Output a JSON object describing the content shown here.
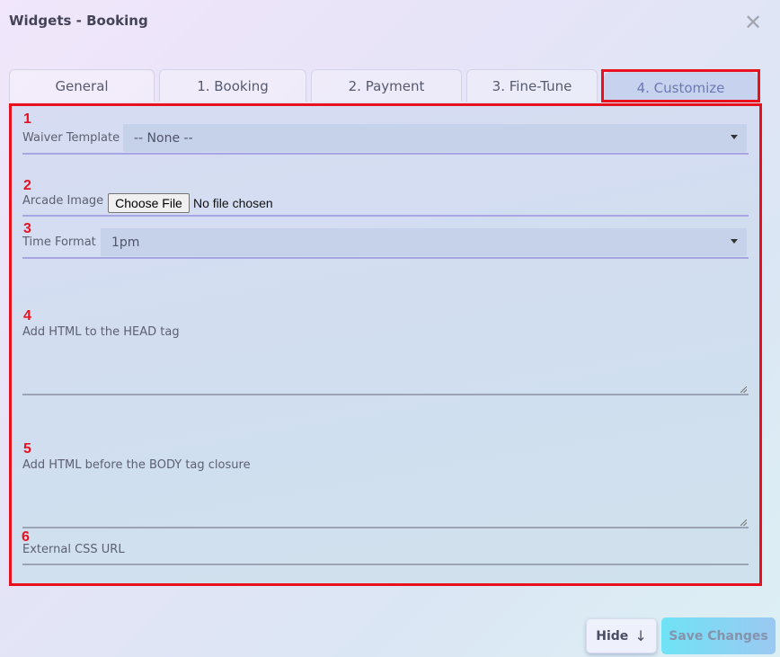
{
  "window": {
    "title": "Widgets - Booking",
    "close_icon": "close-icon"
  },
  "tabs": [
    {
      "label": "General"
    },
    {
      "label": "1. Booking"
    },
    {
      "label": "2. Payment"
    },
    {
      "label": "3. Fine-Tune"
    },
    {
      "label": "4. Customize",
      "active": true
    }
  ],
  "annotations": {
    "highlight_color": "#e8121f",
    "numbers": [
      "1",
      "2",
      "3",
      "4",
      "5",
      "6"
    ]
  },
  "form": {
    "waiver_template": {
      "label": "Waiver Template",
      "value": "-- None --"
    },
    "arcade_image": {
      "label": "Arcade Image",
      "button": "Choose File",
      "status": "No file chosen"
    },
    "time_format": {
      "label": "Time Format",
      "value": "1pm"
    },
    "head_html": {
      "label": "Add HTML to the HEAD tag",
      "value": ""
    },
    "body_html": {
      "label": "Add HTML before the BODY tag closure",
      "value": ""
    },
    "external_css": {
      "label": "External CSS URL",
      "value": ""
    }
  },
  "footer": {
    "hide_label": "Hide",
    "hide_icon": "↓",
    "save_label": "Save Changes"
  }
}
